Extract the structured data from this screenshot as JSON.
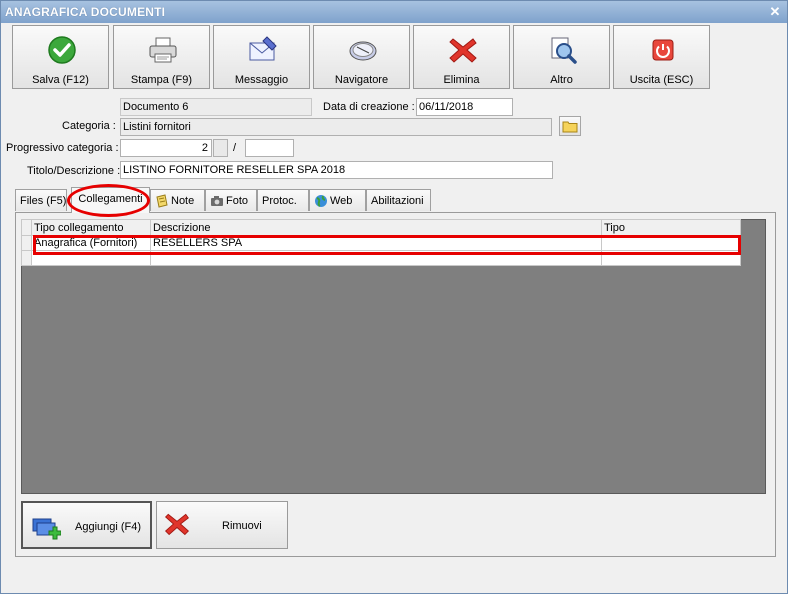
{
  "window": {
    "title": "ANAGRAFICA DOCUMENTI",
    "close_label": "✕"
  },
  "toolbar": {
    "save_label": "Salva (F12)",
    "print_label": "Stampa (F9)",
    "message_label": "Messaggio",
    "navigator_label": "Navigatore",
    "delete_label": "Elimina",
    "other_label": "Altro",
    "exit_label": "Uscita (ESC)"
  },
  "form": {
    "document_name": "Documento 6",
    "creation_date_label": "Data di creazione :",
    "creation_date": "06/11/2018",
    "category_label": "Categoria :",
    "category_value": "Listini fornitori",
    "progressive_label": "Progressivo categoria :",
    "progressive_value": "2",
    "progressive_sep": "/",
    "progressive_total": "",
    "title_label": "Titolo/Descrizione :",
    "title_value": "LISTINO FORNITORE RESELLER SPA 2018"
  },
  "tabs": [
    {
      "label": "Files (F5)",
      "icon": "none"
    },
    {
      "label": "Collegamenti",
      "icon": "none",
      "active": true
    },
    {
      "label": "Note",
      "icon": "notes-icon"
    },
    {
      "label": "Foto",
      "icon": "camera-icon"
    },
    {
      "label": "Protoc.",
      "icon": "none"
    },
    {
      "label": "Web",
      "icon": "globe-icon"
    },
    {
      "label": "Abilitazioni",
      "icon": "none"
    }
  ],
  "links_table": {
    "columns": [
      "Tipo collegamento",
      "Descrizione",
      "Tipo"
    ],
    "rows": [
      [
        "Anagrafica (Fornitori)",
        "RESELLERS SPA",
        ""
      ]
    ]
  },
  "bottom_buttons": {
    "add_label": "Aggiungi (F4)",
    "remove_label": "Rimuovi"
  },
  "colors": {
    "highlight": "#e60000",
    "titlebar": "#7fa2cc",
    "grid_background": "#7f7f7f"
  }
}
